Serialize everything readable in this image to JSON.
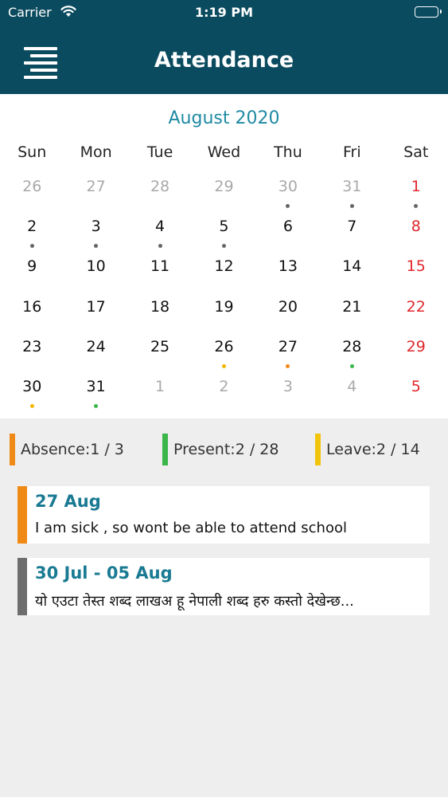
{
  "status_bar": {
    "carrier": "Carrier",
    "time": "1:19 PM"
  },
  "header": {
    "title": "Attendance",
    "menu_icon": "menu-icon"
  },
  "calendar": {
    "month_label": "August 2020",
    "weekdays": [
      "Sun",
      "Mon",
      "Tue",
      "Wed",
      "Thu",
      "Fri",
      "Sat"
    ],
    "weeks": [
      [
        {
          "d": "26",
          "muted": true
        },
        {
          "d": "27",
          "muted": true
        },
        {
          "d": "28",
          "muted": true
        },
        {
          "d": "29",
          "muted": true
        },
        {
          "d": "30",
          "muted": true,
          "dot": "#666666"
        },
        {
          "d": "31",
          "muted": true,
          "dot": "#666666"
        },
        {
          "d": "1",
          "sat": true,
          "dot": "#666666"
        }
      ],
      [
        {
          "d": "2",
          "dot": "#666666"
        },
        {
          "d": "3",
          "dot": "#666666"
        },
        {
          "d": "4",
          "dot": "#666666"
        },
        {
          "d": "5",
          "dot": "#666666"
        },
        {
          "d": "6"
        },
        {
          "d": "7"
        },
        {
          "d": "8",
          "sat": true
        }
      ],
      [
        {
          "d": "9"
        },
        {
          "d": "10"
        },
        {
          "d": "11"
        },
        {
          "d": "12"
        },
        {
          "d": "13"
        },
        {
          "d": "14"
        },
        {
          "d": "15",
          "sat": true
        }
      ],
      [
        {
          "d": "16"
        },
        {
          "d": "17"
        },
        {
          "d": "18"
        },
        {
          "d": "19"
        },
        {
          "d": "20"
        },
        {
          "d": "21"
        },
        {
          "d": "22",
          "sat": true
        }
      ],
      [
        {
          "d": "23"
        },
        {
          "d": "24"
        },
        {
          "d": "25"
        },
        {
          "d": "26",
          "dot": "#f2b800"
        },
        {
          "d": "27",
          "dot": "#f08a16"
        },
        {
          "d": "28",
          "dot": "#3cb54a"
        },
        {
          "d": "29",
          "sat": true
        }
      ],
      [
        {
          "d": "30",
          "dot": "#f2b800"
        },
        {
          "d": "31",
          "dot": "#3cb54a"
        },
        {
          "d": "1",
          "muted": true
        },
        {
          "d": "2",
          "muted": true
        },
        {
          "d": "3",
          "muted": true
        },
        {
          "d": "4",
          "muted": true
        },
        {
          "d": "5",
          "sat": true
        }
      ]
    ]
  },
  "summary": {
    "absence": {
      "label": "Absence:1 / 3",
      "color": "#f08a16"
    },
    "present": {
      "label": "Present:2 / 28",
      "color": "#3cb54a"
    },
    "leave": {
      "label": "Leave:2 / 14",
      "color": "#f2c40c"
    }
  },
  "records": [
    {
      "date": "27 Aug",
      "message": "I am sick , so wont  be able to attend school",
      "color": "#f08a16"
    },
    {
      "date": "30 Jul - 05 Aug",
      "message": "यो एउटा तेस्त शब्द लाखअ हू नेपाली शब्द हरु कस्तो देखेन्छ...",
      "color": "#6d6d6d"
    }
  ]
}
